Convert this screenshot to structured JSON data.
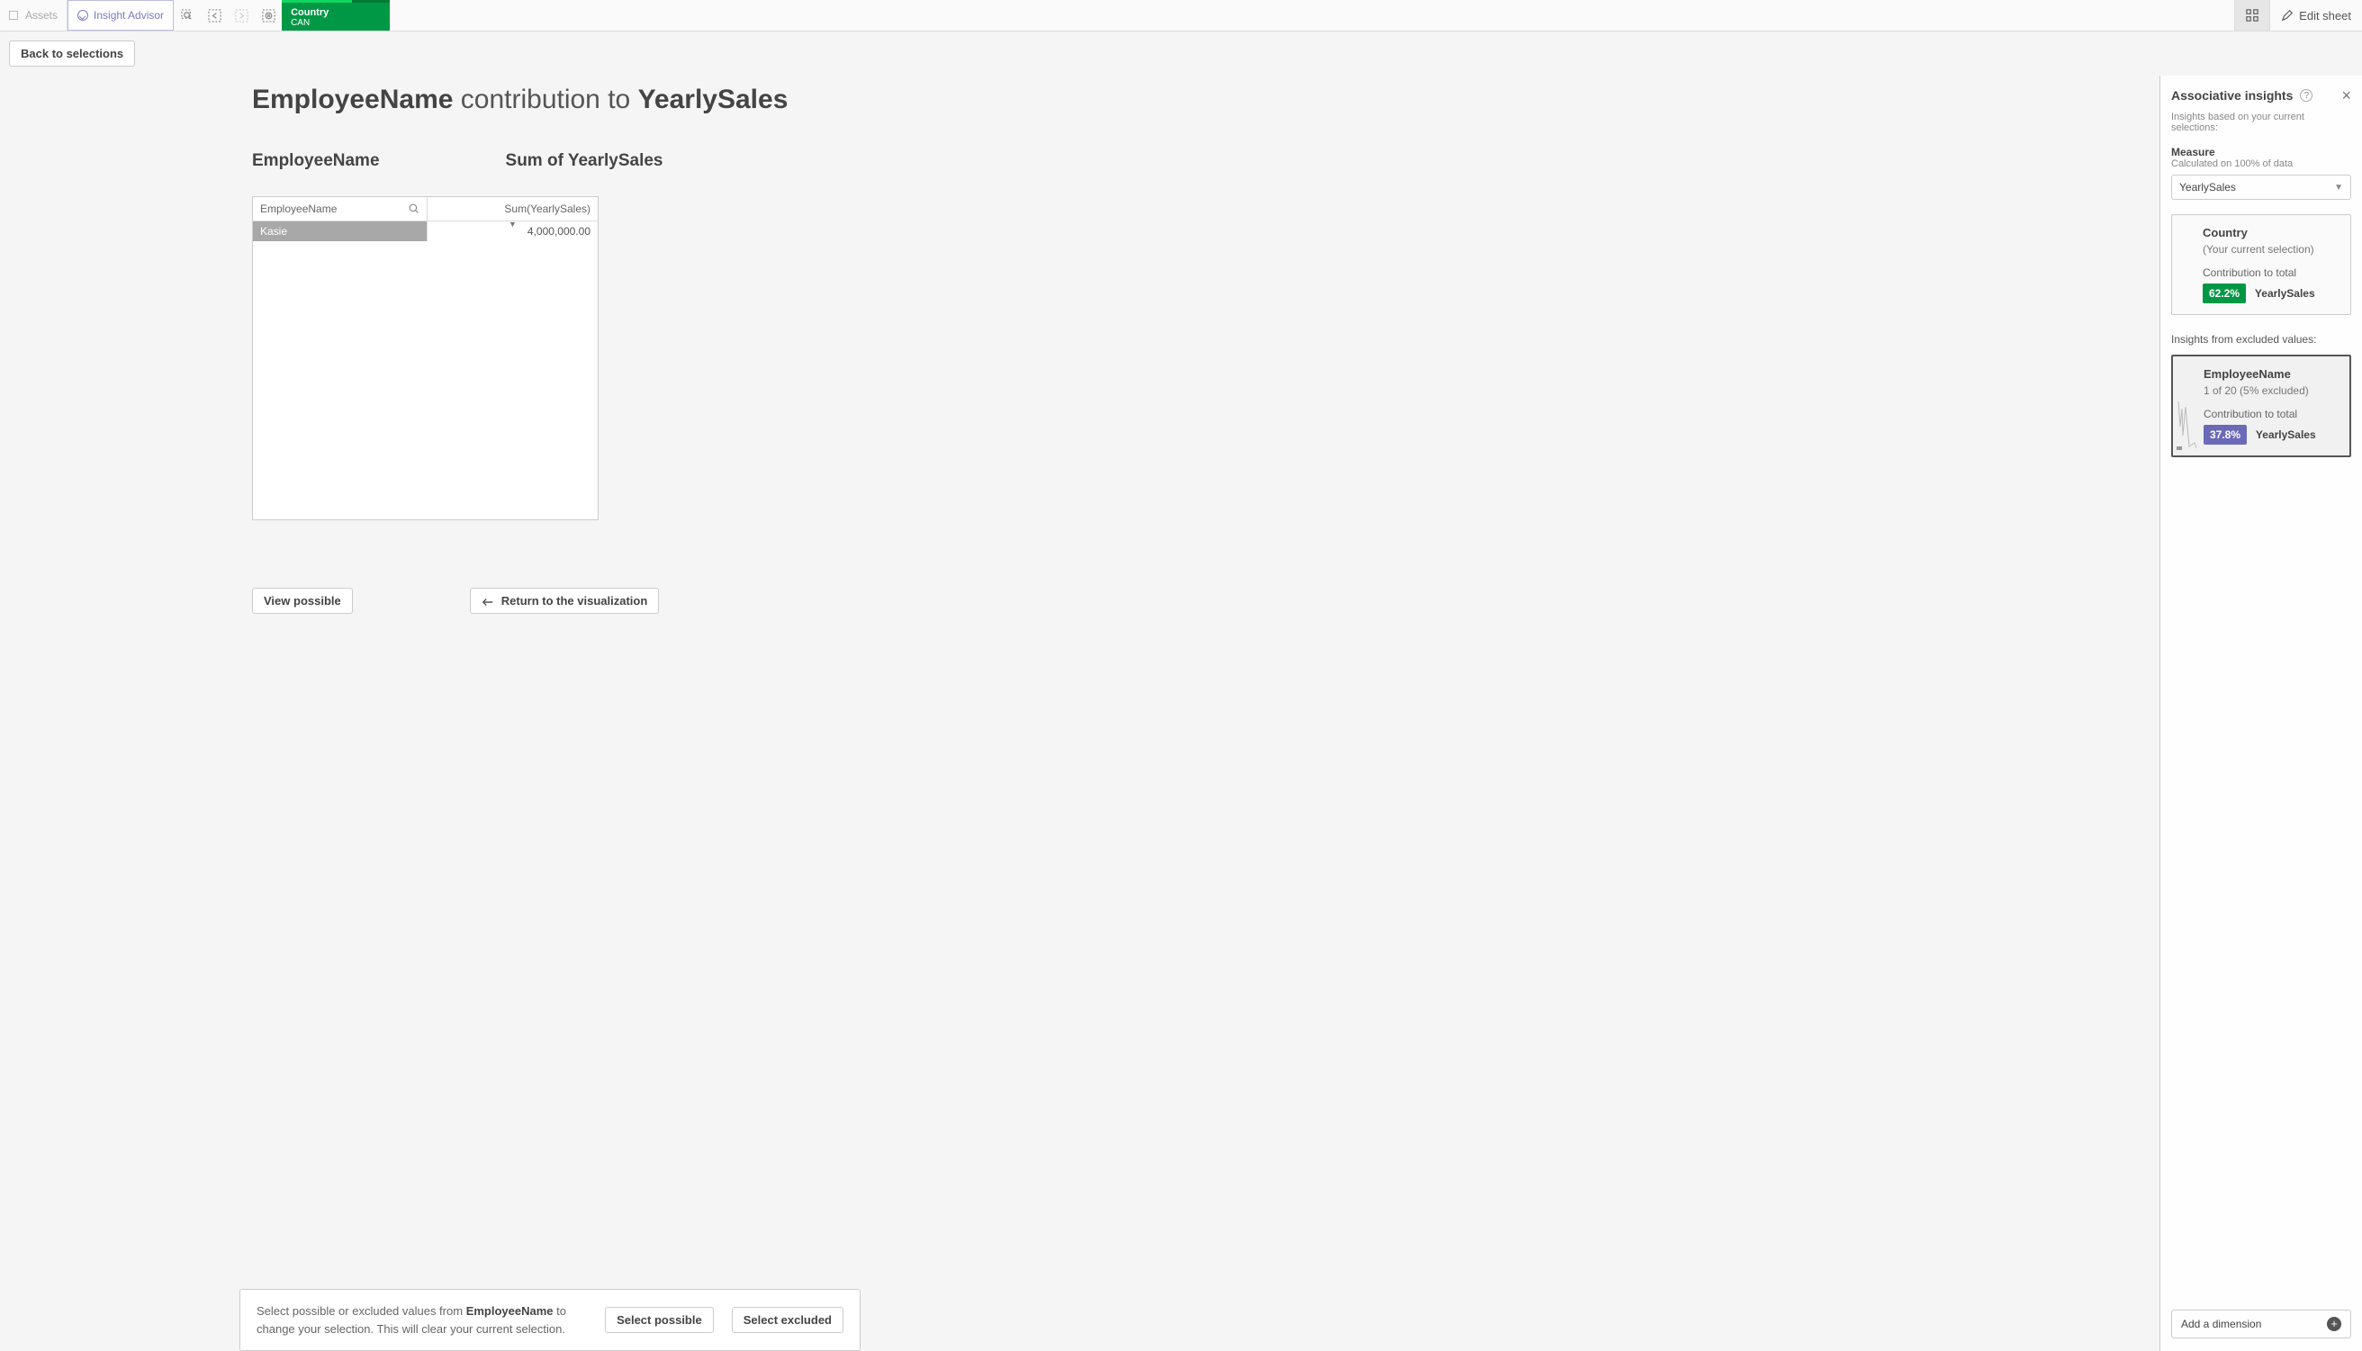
{
  "topbar": {
    "assets_label": "Assets",
    "insight_label": "Insight Advisor",
    "selection": {
      "field": "Country",
      "value": "CAN"
    },
    "edit_label": "Edit sheet"
  },
  "back_label": "Back to selections",
  "title": {
    "field_a": "EmployeeName",
    "mid": " contribution to ",
    "field_b": "YearlySales"
  },
  "col_headers": {
    "c1": "EmployeeName",
    "c2": "Sum of YearlySales"
  },
  "table": {
    "header_c1": "EmployeeName",
    "header_c2": "Sum(YearlySales)",
    "rows": [
      {
        "name": "Kasie",
        "value": "4,000,000.00"
      }
    ]
  },
  "buttons": {
    "view_possible": "View possible",
    "return_viz": "Return to the visualization",
    "select_possible": "Select possible",
    "select_excluded": "Select excluded"
  },
  "helpbar": {
    "pre": "Select possible or excluded values from ",
    "bold": "EmployeeName",
    "post": " to change your selection. This will clear your current selection."
  },
  "panel": {
    "title": "Associative insights",
    "subtitle": "Insights based on your current selections:",
    "measure_label": "Measure",
    "measure_note": "Calculated on 100% of data",
    "measure_value": "YearlySales",
    "card_country": {
      "title": "Country",
      "meta": "(Your current selection)",
      "contrib_label": "Contribution to total",
      "pct": "62.2%",
      "measure": "YearlySales"
    },
    "excluded_label": "Insights from excluded values:",
    "card_emp": {
      "title": "EmployeeName",
      "meta": "1 of 20 (5% excluded)",
      "contrib_label": "Contribution to total",
      "pct": "37.8%",
      "measure": "YearlySales"
    },
    "add_dimension": "Add a dimension"
  }
}
